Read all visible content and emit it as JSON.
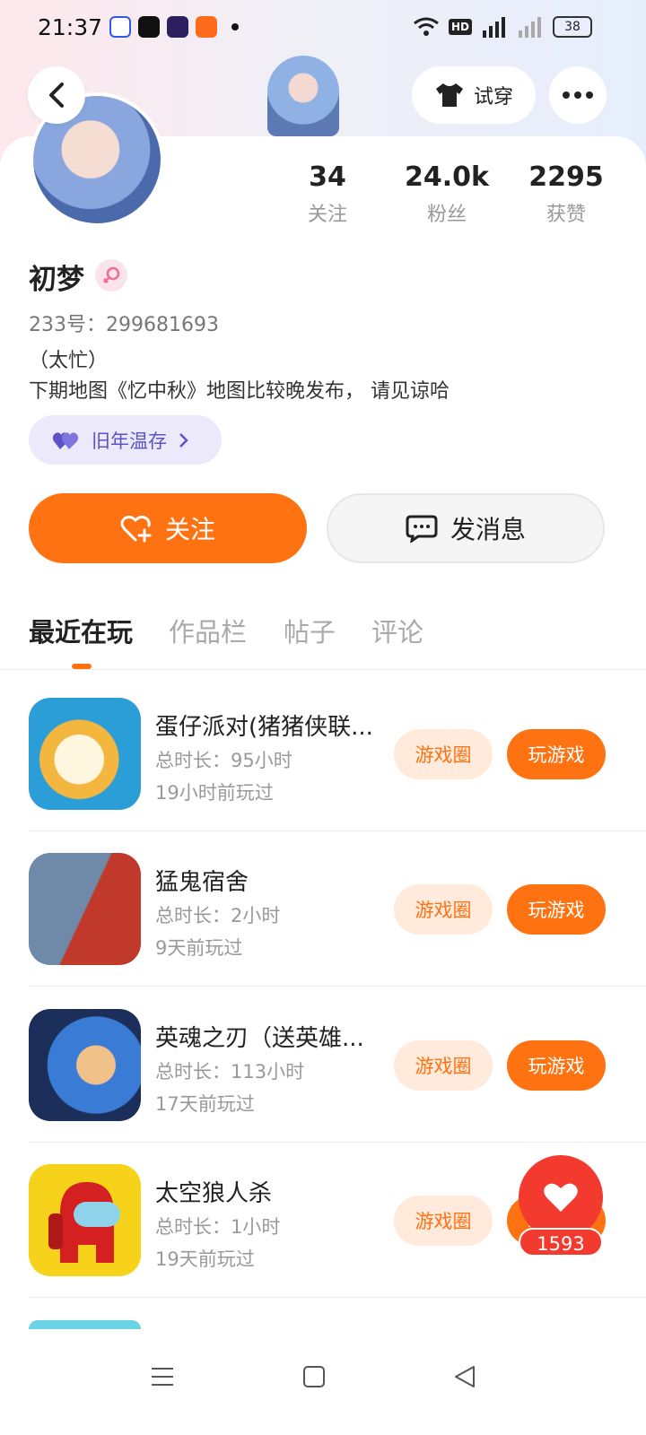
{
  "status_bar": {
    "time": "21:37",
    "battery": "38",
    "hd": "HD"
  },
  "header": {
    "tryon_label": "试穿"
  },
  "profile": {
    "stats": [
      {
        "value": "34",
        "label": "关注"
      },
      {
        "value": "24.0k",
        "label": "粉丝"
      },
      {
        "value": "2295",
        "label": "获赞"
      }
    ],
    "name": "初梦",
    "uid": "233号：299681693",
    "bio_line1": "（太忙）",
    "bio_line2": "下期地图《忆中秋》地图比较晚发布， 请见谅哈",
    "badge_label": "旧年温存"
  },
  "actions": {
    "follow_label": "关注",
    "message_label": "发消息"
  },
  "tabs": [
    "最近在玩",
    "作品栏",
    "帖子",
    "评论"
  ],
  "games": [
    {
      "name": "蛋仔派对(猪猪侠联...",
      "duration": "总时长：95小时",
      "last_played": "19小时前玩过",
      "circle_label": "游戏圈",
      "play_label": "玩游戏"
    },
    {
      "name": "猛鬼宿舍",
      "duration": "总时长：2小时",
      "last_played": "9天前玩过",
      "circle_label": "游戏圈",
      "play_label": "玩游戏"
    },
    {
      "name": "英魂之刃（送英雄...",
      "duration": "总时长：113小时",
      "last_played": "17天前玩过",
      "circle_label": "游戏圈",
      "play_label": "玩游戏"
    },
    {
      "name": "太空狼人杀",
      "duration": "总时长：1小时",
      "last_played": "19天前玩过",
      "circle_label": "游戏圈",
      "play_label": "玩游戏"
    }
  ],
  "floating_like": {
    "count": "1593"
  },
  "colors": {
    "accent": "#ff7212",
    "like": "#f23b2e",
    "badge_text": "#5b53c6"
  }
}
